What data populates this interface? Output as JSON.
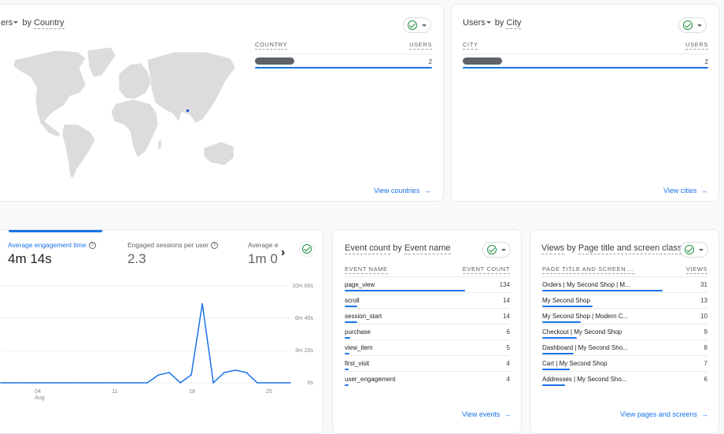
{
  "country_card": {
    "title_prefix": "ers",
    "title_by": "by",
    "title_dim": "Country",
    "col_dim": "COUNTRY",
    "col_metric": "USERS",
    "rows": [
      {
        "label": "[redacted]",
        "value": "2",
        "share": 1.0
      }
    ],
    "highlighted_country": "Bangladesh",
    "link": "View countries",
    "link_arrow": "→"
  },
  "city_card": {
    "title_prefix": "Users",
    "title_by": "by",
    "title_dim": "City",
    "col_dim": "CITY",
    "col_metric": "USERS",
    "rows": [
      {
        "label": "[redacted]",
        "value": "2",
        "share": 1.0
      }
    ],
    "link": "View cities",
    "link_arrow": "→"
  },
  "engagement_card": {
    "metrics": [
      {
        "label": "Average engagement time",
        "value": "4m 14s",
        "active": true
      },
      {
        "label": "Engaged sessions per user",
        "value": "2.3",
        "active": false
      },
      {
        "label": "Average e",
        "value": "1m 0",
        "active": false
      }
    ],
    "next_arrow": "›",
    "help_glyph": "?"
  },
  "chart_data": {
    "type": "line",
    "title": "Average engagement time",
    "xlabel": "",
    "ylabel": "",
    "x_tick_labels": [
      {
        "day": 4,
        "label": "04",
        "sub": "Aug"
      },
      {
        "day": 11,
        "label": "11",
        "sub": ""
      },
      {
        "day": 18,
        "label": "18",
        "sub": ""
      },
      {
        "day": 25,
        "label": "25",
        "sub": ""
      }
    ],
    "y_ticks": [
      {
        "value": 0,
        "label": "0s"
      },
      {
        "value": 200,
        "label": "3m 20s"
      },
      {
        "value": 400,
        "label": "6m 40s"
      },
      {
        "value": 600,
        "label": "10m 00s"
      }
    ],
    "ylim": [
      0,
      600
    ],
    "xlim_days": [
      0.7,
      27
    ],
    "grid": true,
    "series": [
      {
        "name": "Average engagement time (seconds)",
        "color": "#1a73e8",
        "x_days": [
          0.7,
          1,
          2,
          3,
          4,
          5,
          6,
          7,
          8,
          9,
          10,
          11,
          12,
          13,
          14,
          15,
          16,
          17,
          18,
          19,
          20,
          21,
          22,
          23,
          24,
          25,
          26,
          27
        ],
        "values": [
          0,
          0,
          0,
          0,
          0,
          0,
          0,
          0,
          0,
          0,
          0,
          0,
          0,
          0,
          0,
          48,
          64,
          0,
          50,
          490,
          0,
          64,
          78,
          64,
          0,
          0,
          0,
          0
        ]
      }
    ]
  },
  "events_card": {
    "title_prefix": "Event count",
    "title_by": "by",
    "title_dim": "Event name",
    "col_dim": "EVENT NAME",
    "col_metric": "EVENT COUNT",
    "rows": [
      {
        "label": "page_view",
        "value": "134",
        "share": 1.0
      },
      {
        "label": "scroll",
        "value": "14",
        "share": 0.104
      },
      {
        "label": "session_start",
        "value": "14",
        "share": 0.104
      },
      {
        "label": "purchase",
        "value": "6",
        "share": 0.045
      },
      {
        "label": "view_item",
        "value": "5",
        "share": 0.037
      },
      {
        "label": "first_visit",
        "value": "4",
        "share": 0.03
      },
      {
        "label": "user_engagement",
        "value": "4",
        "share": 0.03
      }
    ],
    "link": "View events",
    "link_arrow": "→"
  },
  "pages_card": {
    "title_prefix": "Views",
    "title_by": "by",
    "title_dim": "Page title and screen class",
    "col_dim": "PAGE TITLE AND SCREEN ...",
    "col_metric": "VIEWS",
    "rows": [
      {
        "label": "Orders | My Second Shop | M...",
        "value": "31",
        "share": 1.0
      },
      {
        "label": "My Second Shop",
        "value": "13",
        "share": 0.42
      },
      {
        "label": "My Second Shop | Modern C...",
        "value": "10",
        "share": 0.32
      },
      {
        "label": "Checkout | My Second Shop",
        "value": "9",
        "share": 0.29
      },
      {
        "label": "Dashboard | My Second Sho...",
        "value": "8",
        "share": 0.26
      },
      {
        "label": "Cart | My Second Shop",
        "value": "7",
        "share": 0.23
      },
      {
        "label": "Addresses | My Second Sho...",
        "value": "6",
        "share": 0.19
      }
    ],
    "link": "View pages and screens",
    "link_arrow": "→"
  },
  "colors": {
    "accent": "#1a73e8",
    "success": "#1e8e3e",
    "map_land": "#dcdcdc",
    "map_highlight": "#1a56db",
    "background": "#f8f9fa"
  }
}
